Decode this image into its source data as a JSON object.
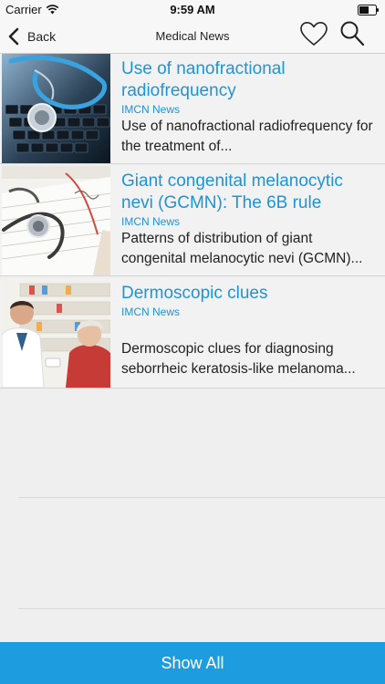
{
  "status_bar": {
    "carrier": "Carrier",
    "time": "9:59 AM",
    "wifi_icon": "wifi-icon",
    "battery_icon": "battery-icon"
  },
  "nav": {
    "back_label": "Back",
    "title": "Medical News",
    "favorites_icon": "heart-icon",
    "search_icon": "search-icon"
  },
  "news": [
    {
      "title": "Use of nanofractional radiofrequency",
      "source": "IMCN News",
      "summary": "Use of nanofractional radiofrequency for the treatment of...",
      "image": "stethoscope-on-keyboard"
    },
    {
      "title": "Giant congenital melanocytic nevi (GCMN): The 6B rule",
      "source": "IMCN News",
      "summary": "Patterns of distribution of giant congenital melanocytic nevi (GCMN)...",
      "image": "stethoscope-on-chart"
    },
    {
      "title": "Dermoscopic clues",
      "source": "IMCN News",
      "summary": "Dermoscopic clues for diagnosing seborrheic keratosis-like melanoma...",
      "image": "pharmacist-with-patient"
    }
  ],
  "footer": {
    "show_all_label": "Show All"
  },
  "colors": {
    "accent": "#1d94d6",
    "footer": "#1e9ce0",
    "background": "#efefef"
  }
}
